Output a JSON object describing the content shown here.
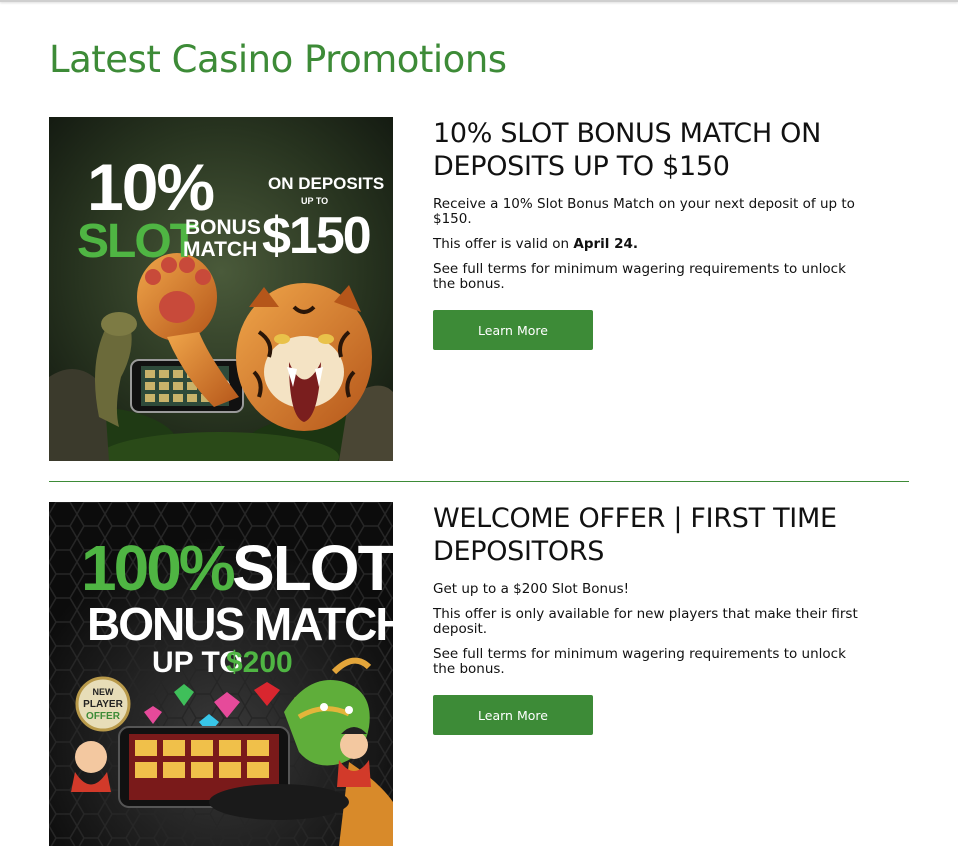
{
  "page": {
    "title": "Latest Casino Promotions"
  },
  "promotions": [
    {
      "title": "10% SLOT BONUS MATCH ON DEPOSITS UP TO $150",
      "desc": "Receive a 10% Slot Bonus Match on your next deposit of up to $150.",
      "validity_prefix": "This offer is valid on ",
      "validity_date": "April 24.",
      "terms": "See full terms for minimum wagering requirements to unlock the bonus.",
      "button_label": "Learn More",
      "banner": {
        "percent": "10%",
        "slot": "SLOT",
        "bonus": "BONUS",
        "match": "MATCH",
        "on_deposits": "ON DEPOSITS",
        "up_to": "UP TO",
        "amount": "$150"
      }
    },
    {
      "title": "WELCOME OFFER | FIRST TIME DEPOSITORS",
      "desc": "Get up to a $200 Slot Bonus!",
      "eligibility": "This offer is only available for new players that make their first deposit.",
      "terms": "See full terms for minimum wagering requirements to unlock the bonus.",
      "button_label": "Learn More",
      "banner": {
        "percent": "100%",
        "slot": "SLOT",
        "bonus_match": "BONUS MATCH",
        "up_to": "UP TO",
        "amount": "$200",
        "badge_new": "NEW",
        "badge_player": "PLAYER",
        "badge_offer": "OFFER"
      }
    }
  ],
  "colors": {
    "brand_green": "#3d8b37",
    "banner_bright_green": "#4fb543"
  }
}
